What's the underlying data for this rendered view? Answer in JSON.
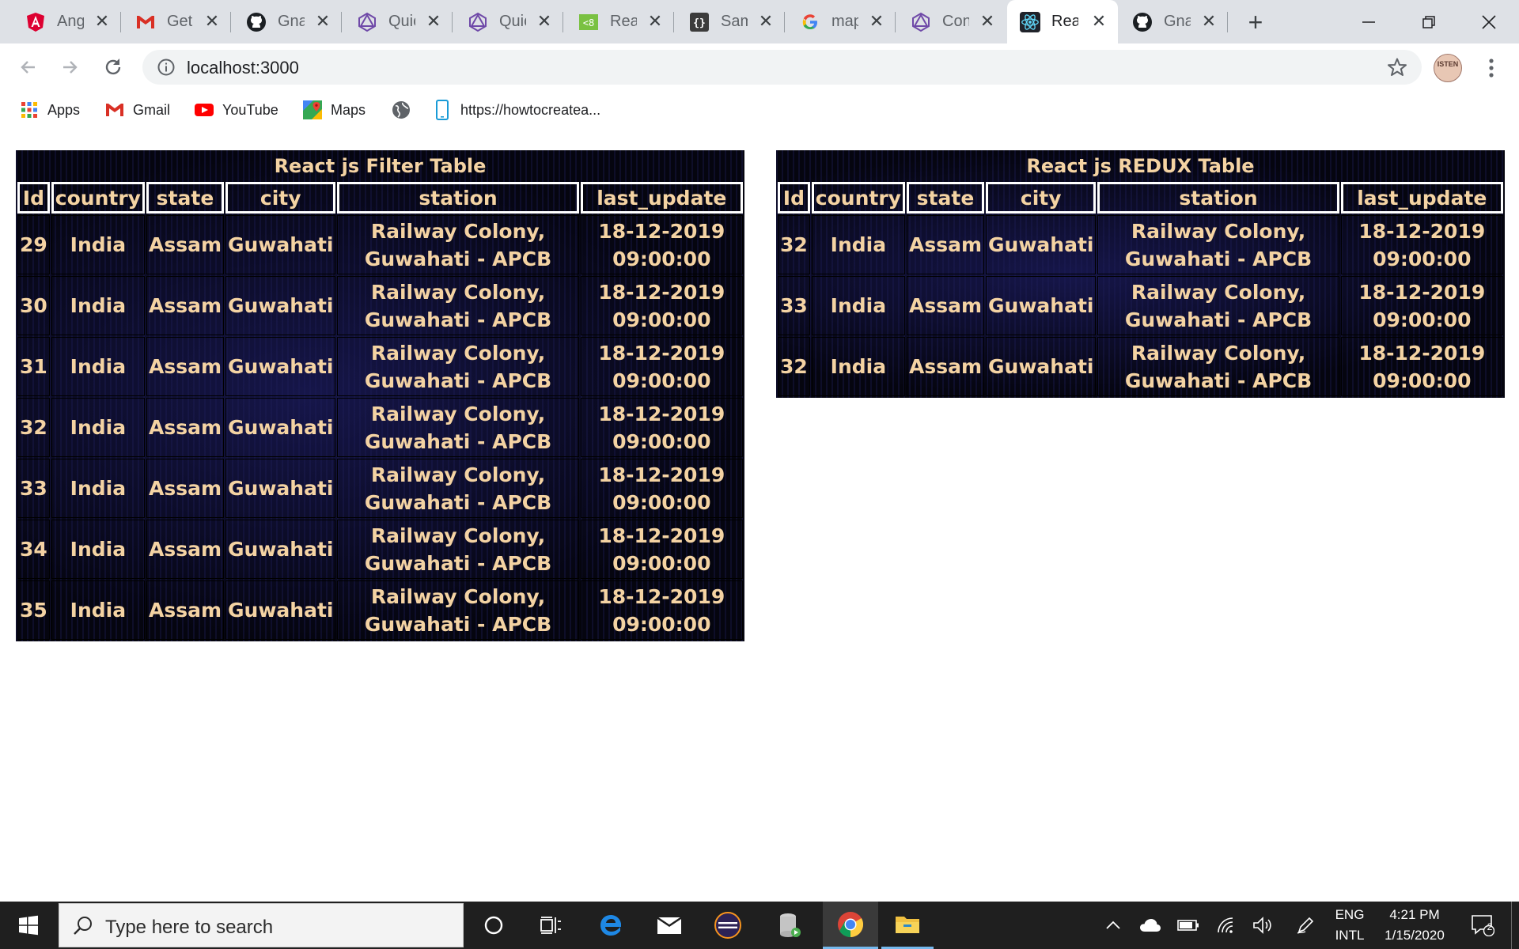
{
  "browser": {
    "tabs": [
      {
        "title": "Ang",
        "icon": "angular-icon"
      },
      {
        "title": "Get",
        "icon": "gmail-icon"
      },
      {
        "title": "Gna",
        "icon": "github-icon"
      },
      {
        "title": "Quic",
        "icon": "graphql-icon"
      },
      {
        "title": "Quic",
        "icon": "graphql-icon"
      },
      {
        "title": "Rea",
        "icon": "codesandbox-icon"
      },
      {
        "title": "Sam",
        "icon": "json-icon"
      },
      {
        "title": "map",
        "icon": "google-icon"
      },
      {
        "title": "Con",
        "icon": "graphql-icon"
      },
      {
        "title": "Rea",
        "icon": "react-icon",
        "active": true
      },
      {
        "title": "Gna",
        "icon": "github-icon"
      }
    ],
    "url": "localhost:3000",
    "bookmarks": [
      {
        "label": "Apps",
        "icon": "apps-grid-icon"
      },
      {
        "label": "Gmail",
        "icon": "gmail-icon"
      },
      {
        "label": "YouTube",
        "icon": "youtube-icon"
      },
      {
        "label": "Maps",
        "icon": "maps-icon"
      },
      {
        "label": "",
        "icon": "globe-icon"
      },
      {
        "label": "https://howtocreatea...",
        "icon": "phone-icon"
      }
    ]
  },
  "filter_table": {
    "caption": "React js Filter Table",
    "headers": [
      "Id",
      "country",
      "state",
      "city",
      "station",
      "last_update"
    ],
    "rows": [
      [
        "29",
        "India",
        "Assam",
        "Guwahati",
        "Railway Colony, Guwahati - APCB",
        "18-12-2019 09:00:00"
      ],
      [
        "30",
        "India",
        "Assam",
        "Guwahati",
        "Railway Colony, Guwahati - APCB",
        "18-12-2019 09:00:00"
      ],
      [
        "31",
        "India",
        "Assam",
        "Guwahati",
        "Railway Colony, Guwahati - APCB",
        "18-12-2019 09:00:00"
      ],
      [
        "32",
        "India",
        "Assam",
        "Guwahati",
        "Railway Colony, Guwahati - APCB",
        "18-12-2019 09:00:00"
      ],
      [
        "33",
        "India",
        "Assam",
        "Guwahati",
        "Railway Colony, Guwahati - APCB",
        "18-12-2019 09:00:00"
      ],
      [
        "34",
        "India",
        "Assam",
        "Guwahati",
        "Railway Colony, Guwahati - APCB",
        "18-12-2019 09:00:00"
      ],
      [
        "35",
        "India",
        "Assam",
        "Guwahati",
        "Railway Colony, Guwahati - APCB",
        "18-12-2019 09:00:00"
      ]
    ]
  },
  "redux_table": {
    "caption": "React js REDUX Table",
    "headers": [
      "Id",
      "country",
      "state",
      "city",
      "station",
      "last_update"
    ],
    "rows": [
      [
        "32",
        "India",
        "Assam",
        "Guwahati",
        "Railway Colony, Guwahati - APCB",
        "18-12-2019 09:00:00"
      ],
      [
        "33",
        "India",
        "Assam",
        "Guwahati",
        "Railway Colony, Guwahati - APCB",
        "18-12-2019 09:00:00"
      ],
      [
        "32",
        "India",
        "Assam",
        "Guwahati",
        "Railway Colony, Guwahati - APCB",
        "18-12-2019 09:00:00"
      ]
    ]
  },
  "taskbar": {
    "search_placeholder": "Type here to search",
    "language": "ENG",
    "layout": "INTL",
    "time": "4:21 PM",
    "date": "1/15/2020",
    "notifications": "2"
  },
  "colors": {
    "table_text": "#f4d3a3",
    "table_bg": "#08081a",
    "tabstrip_bg": "#dee1e6",
    "taskbar_bg": "#1f1f1f"
  }
}
